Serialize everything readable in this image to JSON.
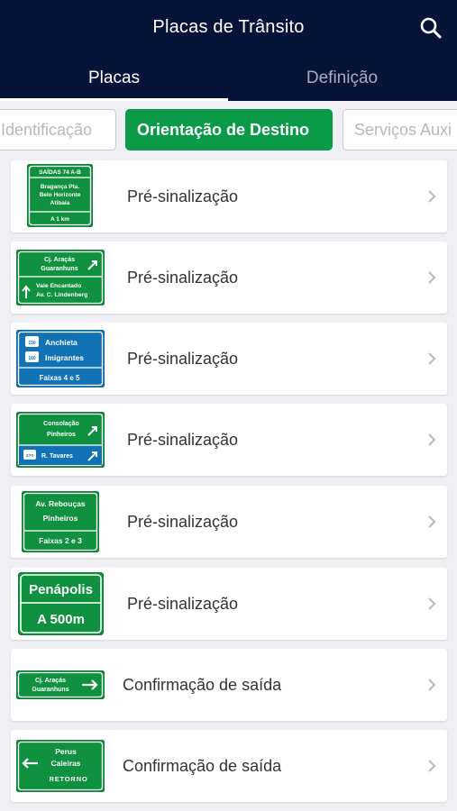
{
  "header": {
    "title": "Placas de Trânsito"
  },
  "tabs": [
    {
      "label": "Placas"
    },
    {
      "label": "Definição"
    }
  ],
  "chips": [
    {
      "label": "Identificação"
    },
    {
      "label": "Orientação de Destino"
    },
    {
      "label": "Serviços Auxi"
    }
  ],
  "items": [
    {
      "label": "Pré-sinalização",
      "sign": {
        "header": "SAÍDAS 74 A-B",
        "lines": [
          "Bragança Pta.",
          "Belo Horizonte",
          "Atibaia"
        ],
        "footer": "A 1 km"
      }
    },
    {
      "label": "Pré-sinalização",
      "sign": {
        "top": [
          "Cj. Araçás",
          "Guaranhuns"
        ],
        "bottom": [
          "Vale Encantado",
          "Av. C. Lindenberg"
        ]
      }
    },
    {
      "label": "Pré-sinalização",
      "sign": {
        "shield1": "150",
        "line1": "Anchieta",
        "shield2": "160",
        "line2": "Imigrantes",
        "footer": "Faixas 4 e 5"
      }
    },
    {
      "label": "Pré-sinalização",
      "sign": {
        "top": [
          "Consolação",
          "Pinheiros"
        ],
        "shield": "270",
        "bottom": "R. Tavares"
      }
    },
    {
      "label": "Pré-sinalização",
      "sign": {
        "lines": [
          "Av. Rebouças",
          "Pinheiros"
        ],
        "footer": "Faixas 2 e 3"
      }
    },
    {
      "label": "Pré-sinalização",
      "sign": {
        "main": "Penápolis",
        "footer": "A 500m"
      }
    },
    {
      "label": "Confirmação de saída",
      "sign": {
        "lines": [
          "Cj. Araçás",
          "Guaranhuns"
        ]
      }
    },
    {
      "label": "Confirmação de saída",
      "sign": {
        "lines": [
          "Perus",
          "Caieiras"
        ],
        "footer": "RETORNO"
      }
    }
  ],
  "colors": {
    "navy": "#07143a",
    "green": "#0a9a48",
    "sign_green": "#10913f",
    "sign_blue": "#1172b6"
  }
}
